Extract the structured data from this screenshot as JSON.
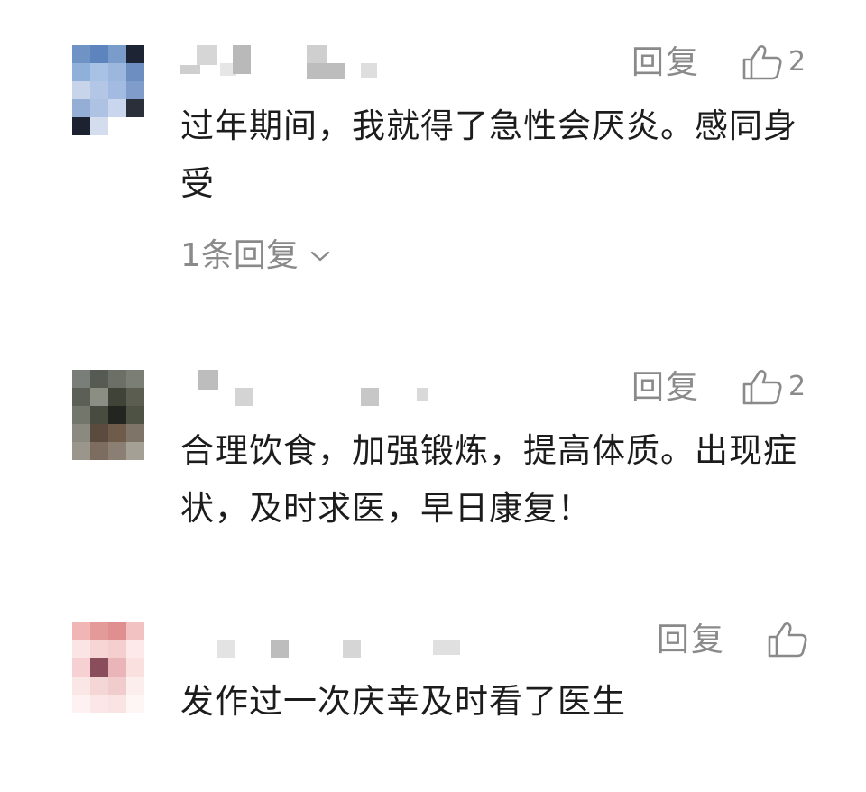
{
  "comments": [
    {
      "reply_label": "回复",
      "like_count": "2",
      "text": "过年期间，我就得了急性会厌炎。感同身受",
      "replies_label": "1条回复"
    },
    {
      "reply_label": "回复",
      "like_count": "2",
      "text": "合理饮食，加强锻炼，提高体质。出现症状，及时求医，早日康复！"
    },
    {
      "reply_label": "回复",
      "like_count": "",
      "text": "发作过一次庆幸及时看了医生"
    }
  ],
  "colors": {
    "muted_text": "#8a8a8a",
    "body_text": "#1c1c1c",
    "background": "#ffffff"
  },
  "icons": {
    "like": "thumbs-up-icon",
    "expand": "chevron-down-icon"
  }
}
